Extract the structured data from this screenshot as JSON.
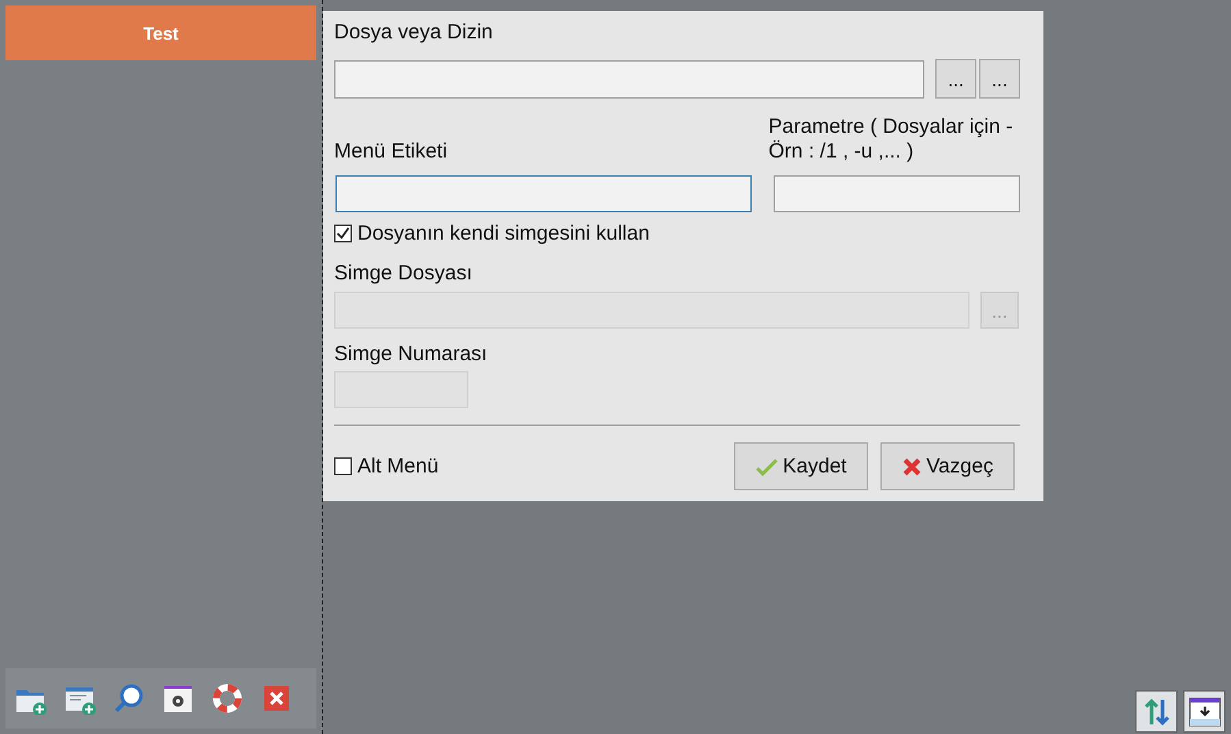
{
  "sidebar": {
    "items": [
      {
        "label": "Test",
        "selected": true
      }
    ]
  },
  "dialog": {
    "path": {
      "label": "Dosya veya Dizin",
      "buttons": [
        "...",
        "..."
      ]
    },
    "menu_label": {
      "label": "Menü Etiketi",
      "focused": true
    },
    "parameter": {
      "label": "Parametre ( Dosyalar için - Örn : /1 , -u ,... )"
    },
    "use_own_icon": {
      "label": "Dosyanın kendi simgesini kullan",
      "checked": true
    },
    "icon_file": {
      "label": "Simge Dosyası",
      "button": "...",
      "disabled": true
    },
    "icon_number": {
      "label": "Simge Numarası",
      "disabled": true
    },
    "submenu": {
      "label": "Alt Menü",
      "checked": false
    },
    "buttons": [
      {
        "label": "Kaydet",
        "kind": "save"
      },
      {
        "label": "Vazgeç",
        "kind": "cancel"
      }
    ]
  }
}
